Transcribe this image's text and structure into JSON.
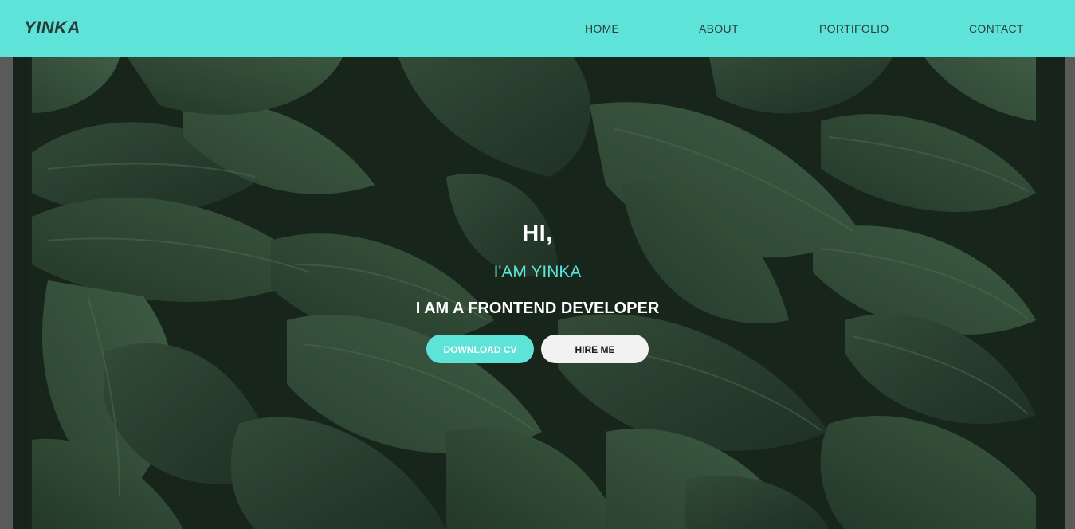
{
  "nav": {
    "brand": "YINKA",
    "links": [
      "HOME",
      "ABOUT",
      "PORTIFOLIO",
      "CONTACT"
    ]
  },
  "hero": {
    "greeting": "HI,",
    "name": "I'AM YINKA",
    "role": "I AM A FRONTEND DEVELOPER",
    "buttons": {
      "download": "DOWNLOAD CV",
      "hire": "HIRE ME"
    },
    "background": "hosta-leaves-photo"
  },
  "colors": {
    "accent": "#5ee3d8",
    "text_light": "#ffffff",
    "button_light": "#f1f1f1",
    "nav_text": "#2f3b3b"
  }
}
